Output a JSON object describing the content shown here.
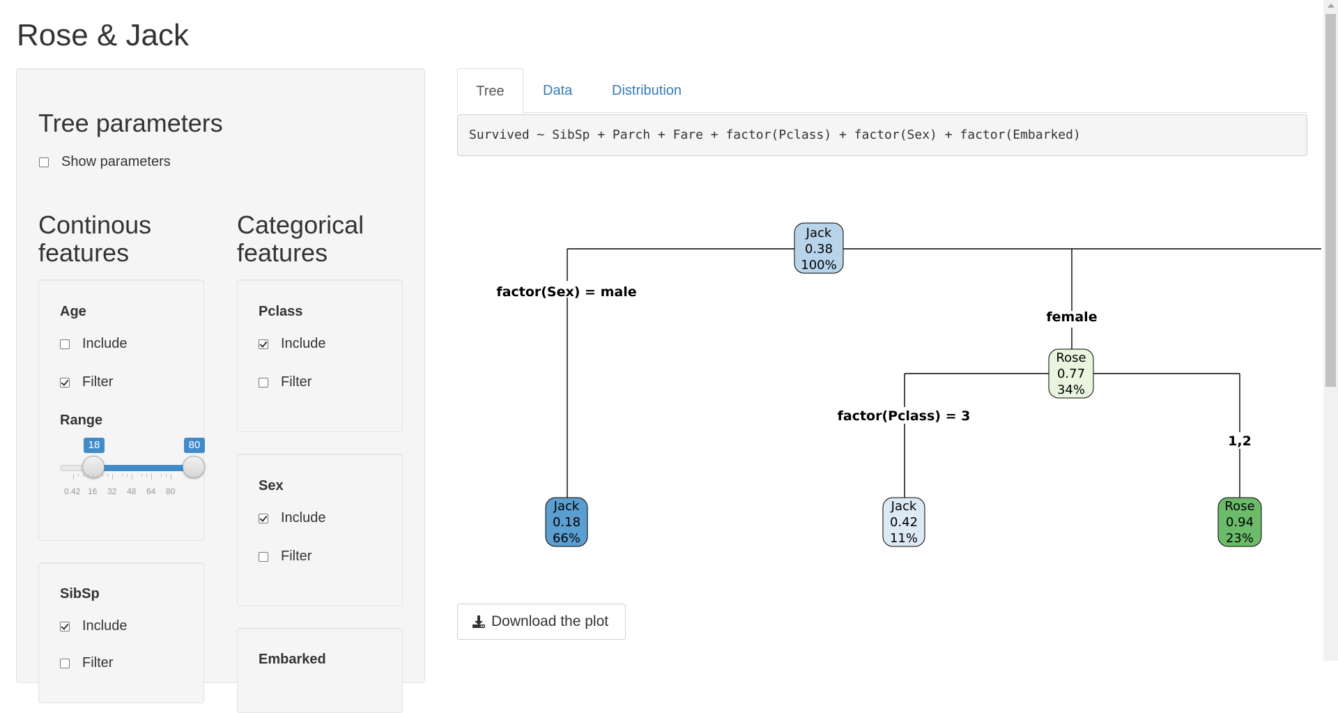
{
  "app": {
    "title": "Rose & Jack"
  },
  "sidebar": {
    "tree_parameters_title": "Tree parameters",
    "show_parameters": {
      "label": "Show parameters",
      "checked": false
    },
    "continuous_title": "Continous features",
    "categorical_title": "Categorical features",
    "continuous": {
      "age": {
        "label": "Age",
        "include": {
          "label": "Include",
          "checked": false
        },
        "filter": {
          "label": "Filter",
          "checked": true
        },
        "range_label": "Range",
        "range_min_value": "18",
        "range_max_value": "80",
        "grid": [
          "0.42",
          "16",
          "32",
          "48",
          "64",
          "80"
        ]
      },
      "sibsp": {
        "label": "SibSp",
        "include": {
          "label": "Include",
          "checked": true
        },
        "filter": {
          "label": "Filter",
          "checked": false
        }
      }
    },
    "categorical": {
      "pclass": {
        "label": "Pclass",
        "include": {
          "label": "Include",
          "checked": true
        },
        "filter": {
          "label": "Filter",
          "checked": false
        }
      },
      "sex": {
        "label": "Sex",
        "include": {
          "label": "Include",
          "checked": true
        },
        "filter": {
          "label": "Filter",
          "checked": false
        }
      },
      "embarked": {
        "label": "Embarked"
      }
    }
  },
  "main": {
    "tabs": [
      {
        "label": "Tree",
        "active": true
      },
      {
        "label": "Data",
        "active": false
      },
      {
        "label": "Distribution",
        "active": false
      }
    ],
    "formula": "Survived ~ SibSp + Parch + Fare + factor(Pclass) + factor(Sex) + factor(Embarked)",
    "download_label": "Download the plot"
  },
  "tree": {
    "nodes": {
      "root": {
        "class": "Jack",
        "value": "0.38",
        "pct": "100%",
        "fill": "#b8d4ea"
      },
      "rose_mid": {
        "class": "Rose",
        "value": "0.77",
        "pct": "34%",
        "fill": "#e9f5df"
      },
      "jack_left": {
        "class": "Jack",
        "value": "0.18",
        "pct": "66%",
        "fill": "#5b9fd1"
      },
      "jack_mid": {
        "class": "Jack",
        "value": "0.42",
        "pct": "11%",
        "fill": "#dde9f5"
      },
      "rose_right": {
        "class": "Rose",
        "value": "0.94",
        "pct": "23%",
        "fill": "#6cbb6a"
      }
    },
    "splits": {
      "sex_left": "factor(Sex) = male",
      "sex_right": "female",
      "pclass_left": "factor(Pclass) = 3",
      "pclass_right": "1,2"
    }
  },
  "colors": {
    "accent": "#428bca",
    "link": "#337ab7"
  }
}
